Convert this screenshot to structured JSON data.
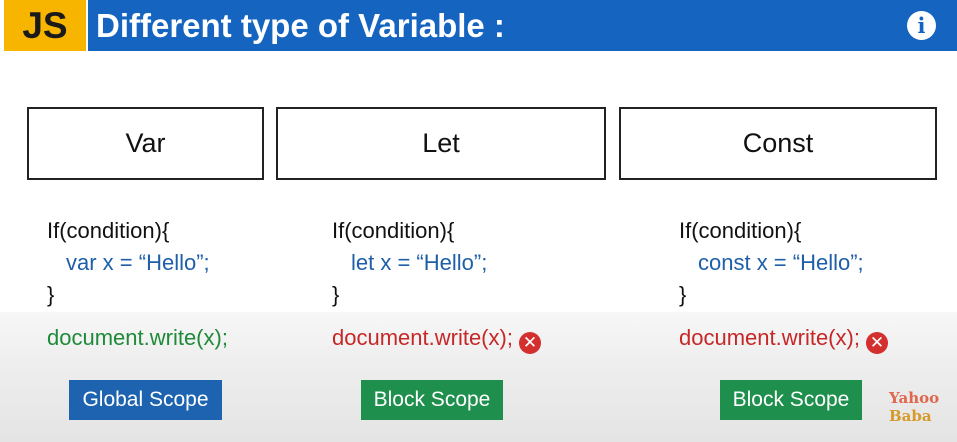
{
  "header": {
    "badge": "JS",
    "title": "Different type of Variable :",
    "info_icon": "i"
  },
  "columns": [
    {
      "keyword": "Var",
      "code_lines": [
        "If(condition){",
        "var x = “Hello”;",
        "}"
      ],
      "output": "document.write(x);",
      "output_status": "ok",
      "scope": "Global Scope"
    },
    {
      "keyword": "Let",
      "code_lines": [
        "If(condition){",
        "let x = “Hello”;",
        "}"
      ],
      "output": "document.write(x);",
      "output_status": "error",
      "scope": "Block Scope"
    },
    {
      "keyword": "Const",
      "code_lines": [
        "If(condition){",
        "const x = “Hello”;",
        "}"
      ],
      "output": "document.write(x);",
      "output_status": "error",
      "scope": "Block Scope"
    }
  ],
  "icons": {
    "error": "close-circle-icon",
    "info": "info-icon"
  },
  "colors": {
    "title_bar": "#1565c0",
    "badge": "#f7b500",
    "ok_text": "#1e8a3a",
    "error_text": "#c62828",
    "global_scope": "#1e63b0",
    "block_scope": "#1e8f4c"
  },
  "logo": {
    "line1": "Yahoo",
    "line2": "Baba"
  }
}
